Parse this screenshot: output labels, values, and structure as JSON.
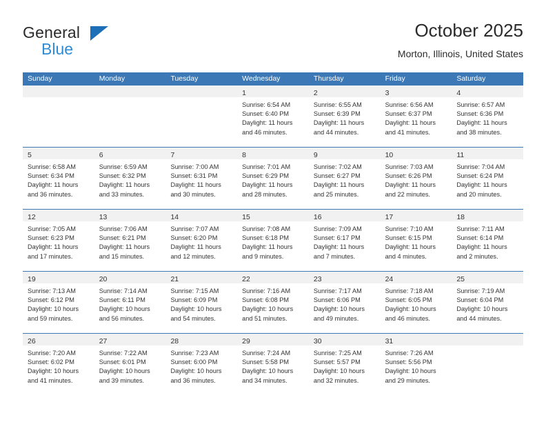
{
  "brand": {
    "name_top": "General",
    "name_bottom": "Blue",
    "triangle_color": "#1d6fb8",
    "blue_color": "#2e8bd4"
  },
  "header": {
    "title": "October 2025",
    "location": "Morton, Illinois, United States"
  },
  "theme": {
    "header_row_bg": "#3b78b5",
    "daynum_band_bg": "#f1f1f1",
    "grid_line": "#3b78b5",
    "text": "#333333"
  },
  "weekday_headers": [
    "Sunday",
    "Monday",
    "Tuesday",
    "Wednesday",
    "Thursday",
    "Friday",
    "Saturday"
  ],
  "labels": {
    "sunrise_prefix": "Sunrise:",
    "sunset_prefix": "Sunset:",
    "daylight_prefix": "Daylight:"
  },
  "weeks": [
    [
      {
        "day": "",
        "empty": true
      },
      {
        "day": "",
        "empty": true
      },
      {
        "day": "",
        "empty": true
      },
      {
        "day": "1",
        "sunrise": "Sunrise: 6:54 AM",
        "sunset": "Sunset: 6:40 PM",
        "daylight": "Daylight: 11 hours and 46 minutes."
      },
      {
        "day": "2",
        "sunrise": "Sunrise: 6:55 AM",
        "sunset": "Sunset: 6:39 PM",
        "daylight": "Daylight: 11 hours and 44 minutes."
      },
      {
        "day": "3",
        "sunrise": "Sunrise: 6:56 AM",
        "sunset": "Sunset: 6:37 PM",
        "daylight": "Daylight: 11 hours and 41 minutes."
      },
      {
        "day": "4",
        "sunrise": "Sunrise: 6:57 AM",
        "sunset": "Sunset: 6:36 PM",
        "daylight": "Daylight: 11 hours and 38 minutes."
      }
    ],
    [
      {
        "day": "5",
        "sunrise": "Sunrise: 6:58 AM",
        "sunset": "Sunset: 6:34 PM",
        "daylight": "Daylight: 11 hours and 36 minutes."
      },
      {
        "day": "6",
        "sunrise": "Sunrise: 6:59 AM",
        "sunset": "Sunset: 6:32 PM",
        "daylight": "Daylight: 11 hours and 33 minutes."
      },
      {
        "day": "7",
        "sunrise": "Sunrise: 7:00 AM",
        "sunset": "Sunset: 6:31 PM",
        "daylight": "Daylight: 11 hours and 30 minutes."
      },
      {
        "day": "8",
        "sunrise": "Sunrise: 7:01 AM",
        "sunset": "Sunset: 6:29 PM",
        "daylight": "Daylight: 11 hours and 28 minutes."
      },
      {
        "day": "9",
        "sunrise": "Sunrise: 7:02 AM",
        "sunset": "Sunset: 6:27 PM",
        "daylight": "Daylight: 11 hours and 25 minutes."
      },
      {
        "day": "10",
        "sunrise": "Sunrise: 7:03 AM",
        "sunset": "Sunset: 6:26 PM",
        "daylight": "Daylight: 11 hours and 22 minutes."
      },
      {
        "day": "11",
        "sunrise": "Sunrise: 7:04 AM",
        "sunset": "Sunset: 6:24 PM",
        "daylight": "Daylight: 11 hours and 20 minutes."
      }
    ],
    [
      {
        "day": "12",
        "sunrise": "Sunrise: 7:05 AM",
        "sunset": "Sunset: 6:23 PM",
        "daylight": "Daylight: 11 hours and 17 minutes."
      },
      {
        "day": "13",
        "sunrise": "Sunrise: 7:06 AM",
        "sunset": "Sunset: 6:21 PM",
        "daylight": "Daylight: 11 hours and 15 minutes."
      },
      {
        "day": "14",
        "sunrise": "Sunrise: 7:07 AM",
        "sunset": "Sunset: 6:20 PM",
        "daylight": "Daylight: 11 hours and 12 minutes."
      },
      {
        "day": "15",
        "sunrise": "Sunrise: 7:08 AM",
        "sunset": "Sunset: 6:18 PM",
        "daylight": "Daylight: 11 hours and 9 minutes."
      },
      {
        "day": "16",
        "sunrise": "Sunrise: 7:09 AM",
        "sunset": "Sunset: 6:17 PM",
        "daylight": "Daylight: 11 hours and 7 minutes."
      },
      {
        "day": "17",
        "sunrise": "Sunrise: 7:10 AM",
        "sunset": "Sunset: 6:15 PM",
        "daylight": "Daylight: 11 hours and 4 minutes."
      },
      {
        "day": "18",
        "sunrise": "Sunrise: 7:11 AM",
        "sunset": "Sunset: 6:14 PM",
        "daylight": "Daylight: 11 hours and 2 minutes."
      }
    ],
    [
      {
        "day": "19",
        "sunrise": "Sunrise: 7:13 AM",
        "sunset": "Sunset: 6:12 PM",
        "daylight": "Daylight: 10 hours and 59 minutes."
      },
      {
        "day": "20",
        "sunrise": "Sunrise: 7:14 AM",
        "sunset": "Sunset: 6:11 PM",
        "daylight": "Daylight: 10 hours and 56 minutes."
      },
      {
        "day": "21",
        "sunrise": "Sunrise: 7:15 AM",
        "sunset": "Sunset: 6:09 PM",
        "daylight": "Daylight: 10 hours and 54 minutes."
      },
      {
        "day": "22",
        "sunrise": "Sunrise: 7:16 AM",
        "sunset": "Sunset: 6:08 PM",
        "daylight": "Daylight: 10 hours and 51 minutes."
      },
      {
        "day": "23",
        "sunrise": "Sunrise: 7:17 AM",
        "sunset": "Sunset: 6:06 PM",
        "daylight": "Daylight: 10 hours and 49 minutes."
      },
      {
        "day": "24",
        "sunrise": "Sunrise: 7:18 AM",
        "sunset": "Sunset: 6:05 PM",
        "daylight": "Daylight: 10 hours and 46 minutes."
      },
      {
        "day": "25",
        "sunrise": "Sunrise: 7:19 AM",
        "sunset": "Sunset: 6:04 PM",
        "daylight": "Daylight: 10 hours and 44 minutes."
      }
    ],
    [
      {
        "day": "26",
        "sunrise": "Sunrise: 7:20 AM",
        "sunset": "Sunset: 6:02 PM",
        "daylight": "Daylight: 10 hours and 41 minutes."
      },
      {
        "day": "27",
        "sunrise": "Sunrise: 7:22 AM",
        "sunset": "Sunset: 6:01 PM",
        "daylight": "Daylight: 10 hours and 39 minutes."
      },
      {
        "day": "28",
        "sunrise": "Sunrise: 7:23 AM",
        "sunset": "Sunset: 6:00 PM",
        "daylight": "Daylight: 10 hours and 36 minutes."
      },
      {
        "day": "29",
        "sunrise": "Sunrise: 7:24 AM",
        "sunset": "Sunset: 5:58 PM",
        "daylight": "Daylight: 10 hours and 34 minutes."
      },
      {
        "day": "30",
        "sunrise": "Sunrise: 7:25 AM",
        "sunset": "Sunset: 5:57 PM",
        "daylight": "Daylight: 10 hours and 32 minutes."
      },
      {
        "day": "31",
        "sunrise": "Sunrise: 7:26 AM",
        "sunset": "Sunset: 5:56 PM",
        "daylight": "Daylight: 10 hours and 29 minutes."
      },
      {
        "day": "",
        "empty": true
      }
    ]
  ]
}
